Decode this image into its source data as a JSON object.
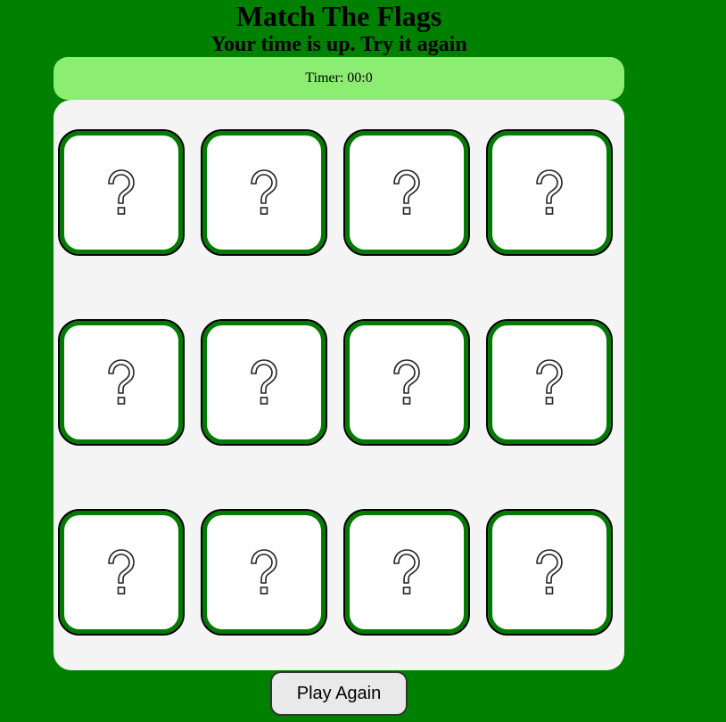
{
  "header": {
    "title": "Match The Flags",
    "status_message": "Your time is up. Try it again"
  },
  "timer": {
    "text": "Timer: 00:0"
  },
  "board": {
    "rows": 3,
    "columns": 4,
    "cards": [
      {
        "state": "face-down",
        "icon": "question-mark-icon"
      },
      {
        "state": "face-down",
        "icon": "question-mark-icon"
      },
      {
        "state": "face-down",
        "icon": "question-mark-icon"
      },
      {
        "state": "face-down",
        "icon": "question-mark-icon"
      },
      {
        "state": "face-down",
        "icon": "question-mark-icon"
      },
      {
        "state": "face-down",
        "icon": "question-mark-icon"
      },
      {
        "state": "face-down",
        "icon": "question-mark-icon"
      },
      {
        "state": "face-down",
        "icon": "question-mark-icon"
      },
      {
        "state": "face-down",
        "icon": "question-mark-icon"
      },
      {
        "state": "face-down",
        "icon": "question-mark-icon"
      },
      {
        "state": "face-down",
        "icon": "question-mark-icon"
      },
      {
        "state": "face-down",
        "icon": "question-mark-icon"
      }
    ]
  },
  "controls": {
    "play_again_label": "Play Again"
  },
  "colors": {
    "background": "#008000",
    "timer_bar": "#8ced73",
    "board": "#f4f4f4",
    "card_face": "#ffffff",
    "card_border": "#007a00",
    "button": "#e9e9e9"
  }
}
